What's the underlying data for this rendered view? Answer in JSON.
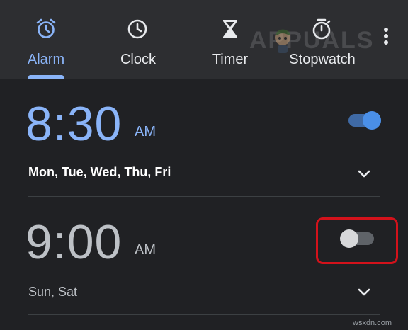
{
  "tabs": [
    {
      "label": "Alarm",
      "icon": "alarm-clock-icon",
      "active": true
    },
    {
      "label": "Clock",
      "icon": "clock-icon",
      "active": false
    },
    {
      "label": "Timer",
      "icon": "hourglass-icon",
      "active": false
    },
    {
      "label": "Stopwatch",
      "icon": "stopwatch-icon",
      "active": false
    }
  ],
  "menu_icon": "more-vert-icon",
  "alarms": [
    {
      "time": "8:30",
      "ampm": "AM",
      "days": "Mon, Tue, Wed, Thu, Fri",
      "enabled": true
    },
    {
      "time": "9:00",
      "ampm": "AM",
      "days": "Sun, Sat",
      "enabled": false
    }
  ],
  "watermark": "APPUALS",
  "credit": "wsxdn.com",
  "colors": {
    "background": "#202124",
    "topbar": "#2d2e31",
    "accent": "#8ab4f8",
    "toggle_on_thumb": "#4a8fe7",
    "highlight_border": "#d3121b"
  }
}
